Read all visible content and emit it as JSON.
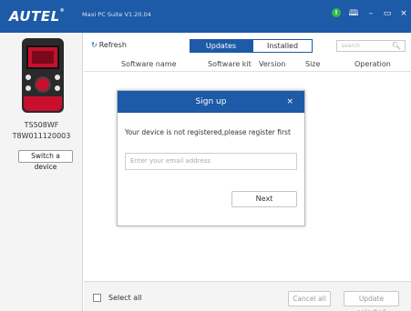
{
  "window": {
    "brand": "AUTEL",
    "brand_mark": "®",
    "title": "Maxi PC Suite V1.20.04",
    "status_icon": "!",
    "controls": [
      "book-icon",
      "minimize-icon",
      "maximize-icon",
      "close-icon"
    ],
    "colors": {
      "titlebar": "#1d5aa7",
      "status": "#2db84a"
    }
  },
  "device": {
    "model": "TS508WF",
    "serial": "T8W011120003",
    "switch_label": "Switch a device"
  },
  "toolbar": {
    "refresh_label": "Refresh",
    "tabs": [
      {
        "label": "Updates available",
        "active": true
      },
      {
        "label": "Installed",
        "active": false
      }
    ],
    "search_placeholder": "search"
  },
  "table": {
    "columns": [
      "Software name",
      "Software kit",
      "Version",
      "Size",
      "Operation"
    ],
    "rows": []
  },
  "dialog": {
    "title": "Sign up",
    "close_symbol": "×",
    "message": "Your device is not registered,please register first",
    "email_placeholder": "Enter your email address",
    "email_value": "",
    "next_label": "Next"
  },
  "footer": {
    "select_all_label": "Select all",
    "select_all_checked": false,
    "cancel_all_label": "Cancel all",
    "update_selected_label": "Update selected"
  }
}
